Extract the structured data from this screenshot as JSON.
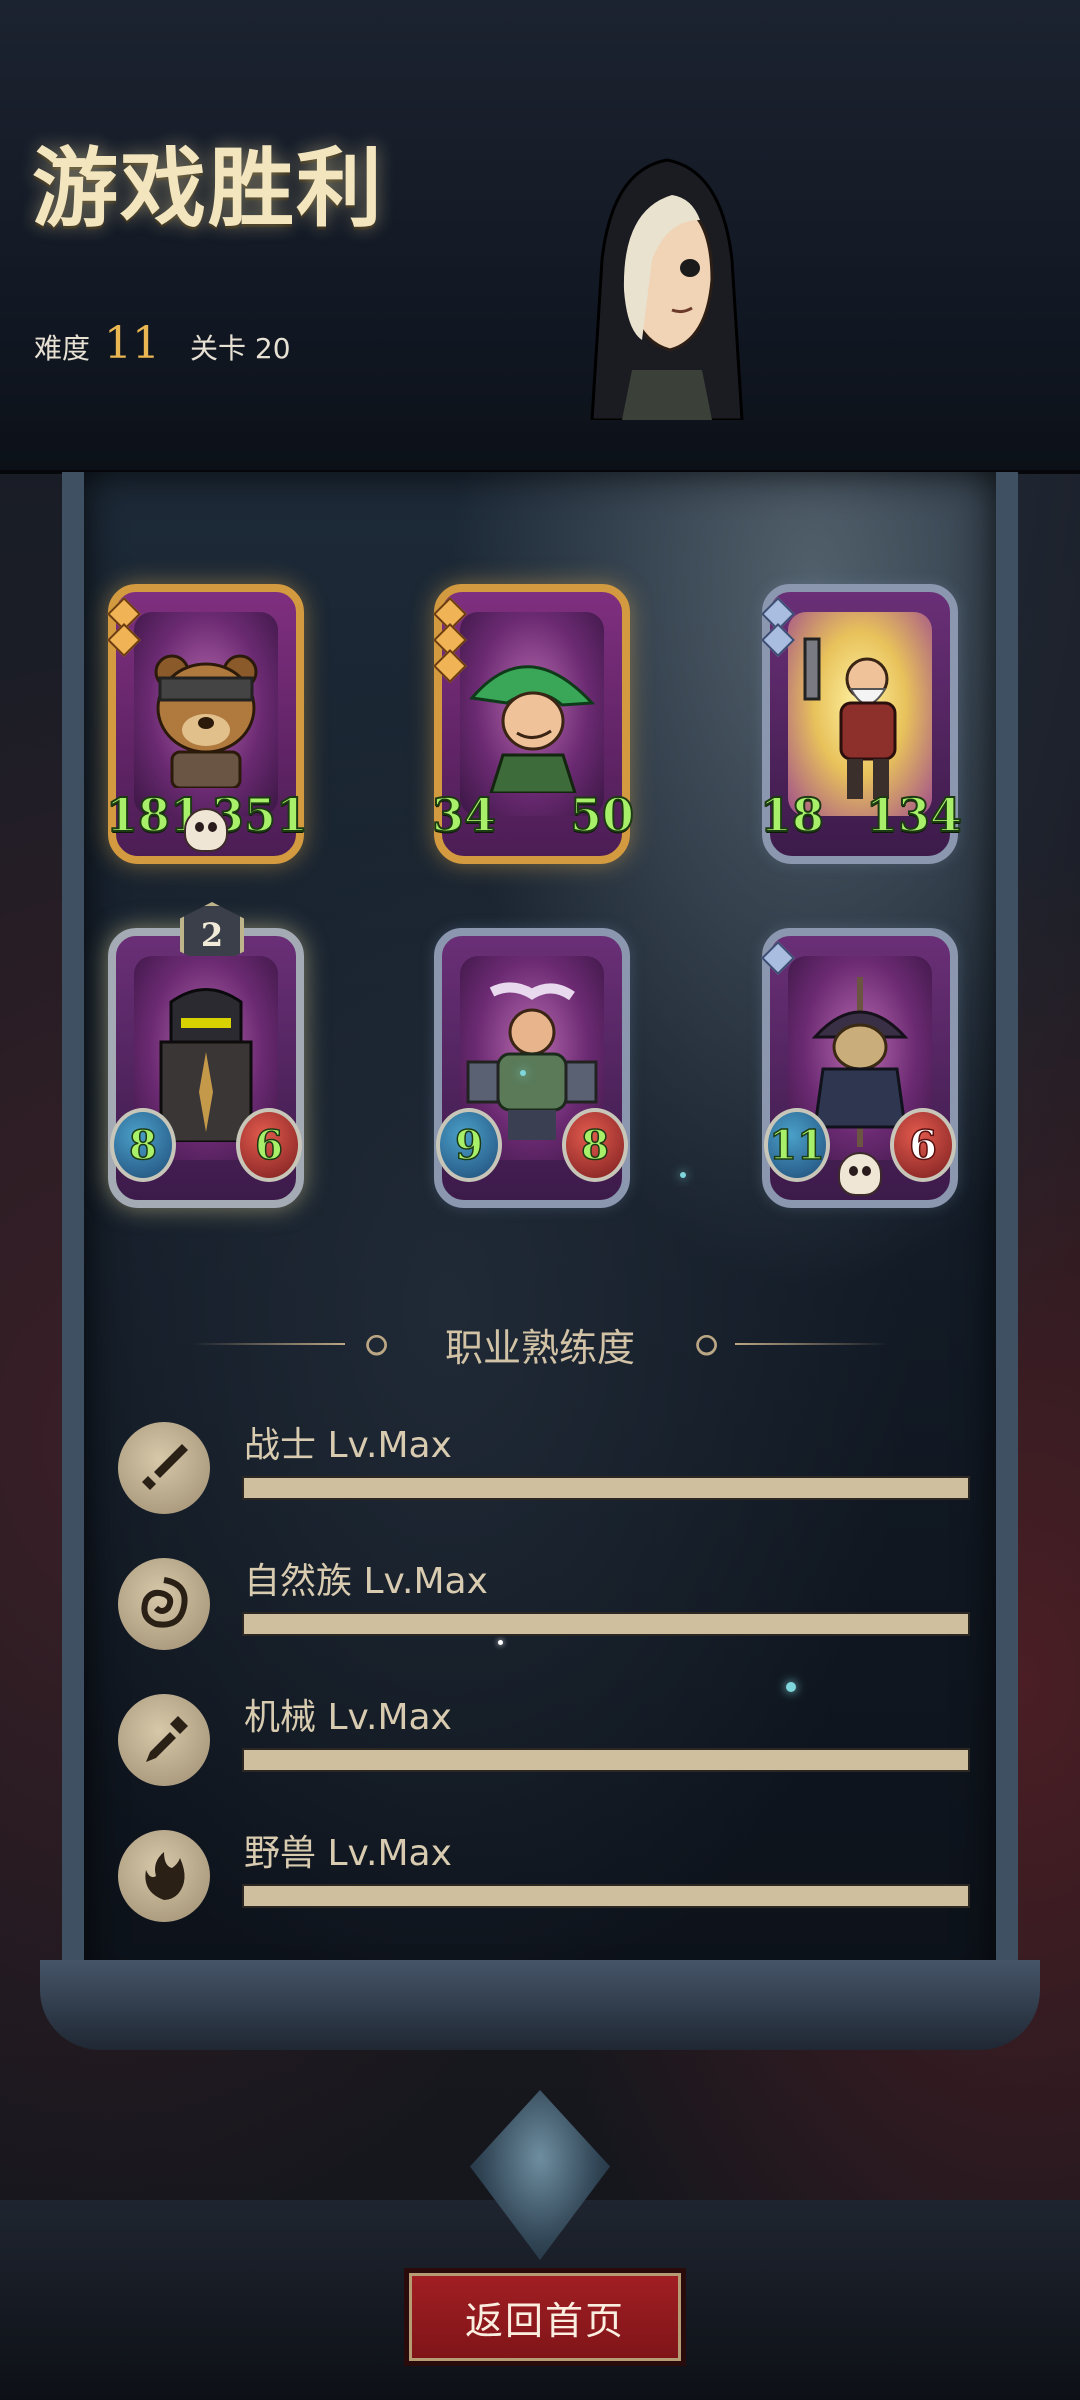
{
  "header": {
    "title": "游戏胜利",
    "difficulty_label": "难度",
    "difficulty_value": "11",
    "stage_label": "关卡 20"
  },
  "cards": [
    {
      "name": "bear-warrior",
      "frame": "gold",
      "attack": "181",
      "health": "351",
      "skull": true,
      "pips": 2
    },
    {
      "name": "green-hat-ranger",
      "frame": "gold",
      "attack": "34",
      "health": "50",
      "skull": false,
      "pips": 3
    },
    {
      "name": "bearded-mechanic",
      "frame": "silver",
      "attack": "18",
      "health": "134",
      "skull": false,
      "pips": 2
    },
    {
      "name": "shield-knight",
      "frame": "silver",
      "attack": "8",
      "health": "6",
      "level": "2"
    },
    {
      "name": "chef-brute",
      "frame": "silver",
      "attack": "9",
      "health": "8"
    },
    {
      "name": "scarecrow",
      "frame": "silver",
      "attack": "11",
      "health": "6",
      "skull": true,
      "pips": 1
    }
  ],
  "proficiency": {
    "title": "职业熟练度",
    "items": [
      {
        "label": "战士 Lv.Max",
        "icon": "warrior-icon",
        "progress": 1.0
      },
      {
        "label": "自然族 Lv.Max",
        "icon": "nature-icon",
        "progress": 1.0
      },
      {
        "label": "机械 Lv.Max",
        "icon": "mechanic-icon",
        "progress": 1.0
      },
      {
        "label": "野兽 Lv.Max",
        "icon": "beast-icon",
        "progress": 1.0
      }
    ]
  },
  "buttons": {
    "home": "返回首页"
  }
}
